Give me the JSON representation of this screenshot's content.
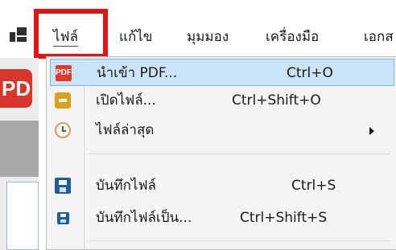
{
  "menubar": {
    "items": [
      {
        "label": "ไฟล์"
      },
      {
        "label": "แก้ไข"
      },
      {
        "label": "มุมมอง"
      },
      {
        "label": "เครื่องมือ"
      },
      {
        "label": "เอกส"
      }
    ]
  },
  "app": {
    "badge": "PD"
  },
  "file_menu": {
    "items": [
      {
        "label": "นำเข้า PDF...",
        "shortcut": "Ctrl+O",
        "icon": "pdf-import-icon",
        "icon_text": "PDF"
      },
      {
        "label": "เปิดไฟล์...",
        "shortcut": "Ctrl+Shift+O",
        "icon": "open-file-icon"
      },
      {
        "label": "ไฟล์ล่าสุด",
        "shortcut": "",
        "icon": "recent-clock-icon",
        "submenu": true
      },
      {
        "label": "บันทึกไฟล์",
        "shortcut": "Ctrl+S",
        "icon": "save-icon"
      },
      {
        "label": "บันทึกไฟล์เป็น...",
        "shortcut": "Ctrl+Shift+S",
        "icon": "save-as-icon"
      }
    ]
  },
  "colors": {
    "highlight_frame": "#e01414",
    "hover_row": "#cce4f7",
    "pdf_red": "#e03a2e",
    "save_blue": "#1d5d9c"
  }
}
